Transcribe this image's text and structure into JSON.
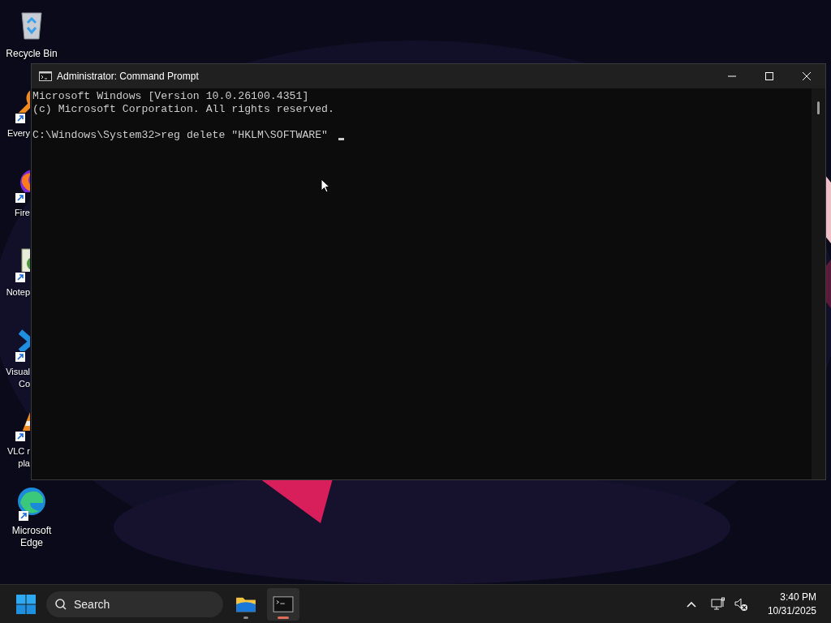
{
  "desktop_icons": [
    {
      "kind": "recycle",
      "label": "Recycle Bin",
      "shortcut": false
    },
    {
      "kind": "search-app",
      "label": "Every",
      "shortcut": true
    },
    {
      "kind": "browser-fox",
      "label": "Fire",
      "shortcut": true
    },
    {
      "kind": "notepad",
      "label": "Notep",
      "shortcut": true
    },
    {
      "kind": "code",
      "label": "Visual\nCo",
      "shortcut": true
    },
    {
      "kind": "cone",
      "label": "VLC r\npla",
      "shortcut": true
    },
    {
      "kind": "edge",
      "label": "Microsoft\nEdge",
      "shortcut": true
    }
  ],
  "window": {
    "title": "Administrator: Command Prompt",
    "console_lines": [
      "Microsoft Windows [Version 10.0.26100.4351]",
      "(c) Microsoft Corporation. All rights reserved."
    ],
    "prompt_line": "C:\\Windows\\System32>reg delete \"HKLM\\SOFTWARE\" "
  },
  "taskbar": {
    "search": {
      "placeholder": "Search"
    },
    "apps": [
      {
        "kind": "folder",
        "selected": false
      },
      {
        "kind": "terminal",
        "selected": true
      }
    ],
    "time": "3:40 PM",
    "date": "10/31/2025"
  }
}
